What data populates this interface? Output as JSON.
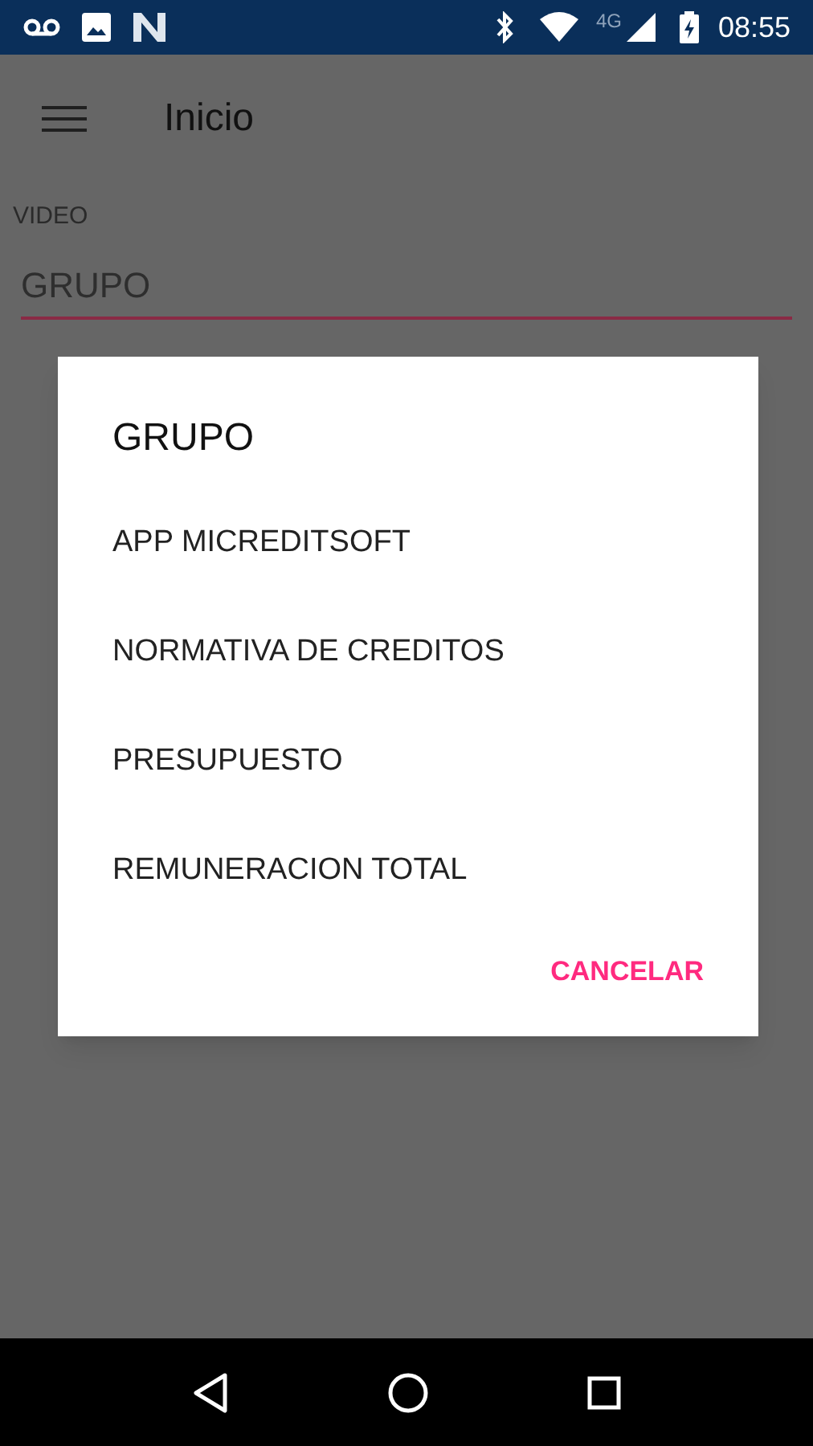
{
  "status_bar": {
    "network": "4G",
    "time": "08:55"
  },
  "app_bar": {
    "title": "Inicio"
  },
  "form": {
    "label": "VIDEO",
    "field": {
      "placeholder": "GRUPO"
    }
  },
  "dialog": {
    "title": "GRUPO",
    "items": [
      "APP MICREDITSOFT",
      "NORMATIVA DE CREDITOS",
      "PRESUPUESTO",
      "REMUNERACION TOTAL"
    ],
    "button": "CANCELAR"
  }
}
